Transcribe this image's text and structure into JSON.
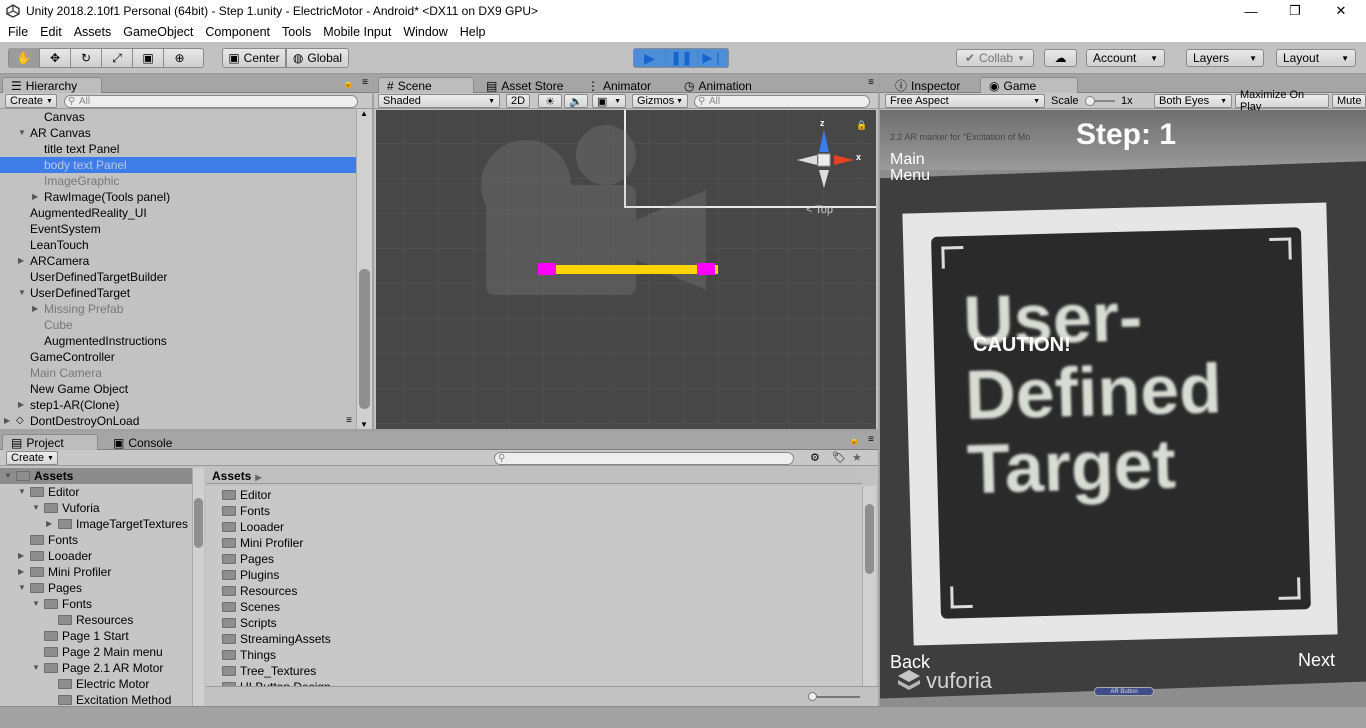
{
  "window": {
    "title": "Unity 2018.2.10f1 Personal (64bit) - Step 1.unity - ElectricMotor - Android* <DX11 on DX9 GPU>",
    "min": "—",
    "max": "❐",
    "close": "✕"
  },
  "menu": [
    "File",
    "Edit",
    "Assets",
    "GameObject",
    "Component",
    "Tools",
    "Mobile Input",
    "Window",
    "Help"
  ],
  "toolbar": {
    "center": "Center",
    "global": "Global",
    "collab": "Collab",
    "account": "Account",
    "layers": "Layers",
    "layout": "Layout"
  },
  "hierarchy": {
    "tab": "Hierarchy",
    "create": "Create",
    "search_placeholder": "All",
    "rows": [
      {
        "t": "Canvas",
        "d": 2,
        "a": "",
        "s": false,
        "dim": false
      },
      {
        "t": "AR Canvas",
        "d": 1,
        "a": "open",
        "s": false,
        "dim": false
      },
      {
        "t": "title text Panel",
        "d": 2,
        "a": "",
        "s": false,
        "dim": false
      },
      {
        "t": "body text Panel",
        "d": 2,
        "a": "",
        "s": true,
        "dim": true
      },
      {
        "t": "ImageGraphic",
        "d": 2,
        "a": "",
        "s": false,
        "dim": true
      },
      {
        "t": "RawImage(Tools panel)",
        "d": 2,
        "a": "closed",
        "s": false,
        "dim": false
      },
      {
        "t": "AugmentedReality_UI",
        "d": 1,
        "a": "",
        "s": false,
        "dim": false
      },
      {
        "t": "EventSystem",
        "d": 1,
        "a": "",
        "s": false,
        "dim": false
      },
      {
        "t": "LeanTouch",
        "d": 1,
        "a": "",
        "s": false,
        "dim": false
      },
      {
        "t": "ARCamera",
        "d": 1,
        "a": "closed",
        "s": false,
        "dim": false
      },
      {
        "t": "UserDefinedTargetBuilder",
        "d": 1,
        "a": "",
        "s": false,
        "dim": false
      },
      {
        "t": "UserDefinedTarget",
        "d": 1,
        "a": "open",
        "s": false,
        "dim": false
      },
      {
        "t": "Missing Prefab",
        "d": 2,
        "a": "closed",
        "s": false,
        "dim": true
      },
      {
        "t": "Cube",
        "d": 2,
        "a": "",
        "s": false,
        "dim": true
      },
      {
        "t": "AugmentedInstructions",
        "d": 2,
        "a": "",
        "s": false,
        "dim": false
      },
      {
        "t": "GameController",
        "d": 1,
        "a": "",
        "s": false,
        "dim": false
      },
      {
        "t": "Main Camera",
        "d": 1,
        "a": "",
        "s": false,
        "dim": true
      },
      {
        "t": "New Game Object",
        "d": 1,
        "a": "",
        "s": false,
        "dim": false
      },
      {
        "t": "step1-AR(Clone)",
        "d": 1,
        "a": "closed",
        "s": false,
        "dim": false
      },
      {
        "t": "DontDestroyOnLoad",
        "d": 0,
        "a": "closed",
        "s": false,
        "dim": false
      }
    ]
  },
  "scene": {
    "tabs": [
      "Scene",
      "Asset Store",
      "Animator",
      "Animation"
    ],
    "shaded": "Shaded",
    "mode2d": "2D",
    "gizmos": "Gizmos",
    "search_placeholder": "All",
    "axis_x": "x",
    "axis_z": "z",
    "view_label": "< Top"
  },
  "inspector": {
    "tab": "Inspector"
  },
  "game": {
    "tab": "Game",
    "aspect": "Free Aspect",
    "scale_label": "Scale",
    "scale_value": "1x",
    "both_eyes": "Both Eyes",
    "maximize": "Maximize On Play",
    "mute": "Mute",
    "step": "Step: 1",
    "main_menu_1": "Main",
    "main_menu_2": "Menu",
    "small_caption": "2.2   AR marker for \"Excitation of Mo",
    "caution": "CAUTION!",
    "marker_1": "User-",
    "marker_2": "Defined",
    "marker_3": "Target",
    "back": "Back",
    "vuforia": "vuforia",
    "next": "Next",
    "ar_button": "AR Button"
  },
  "project": {
    "tabs": [
      "Project",
      "Console"
    ],
    "create": "Create",
    "tree": [
      {
        "t": "Assets",
        "d": 0,
        "a": "open",
        "s": true
      },
      {
        "t": "Editor",
        "d": 1,
        "a": "open",
        "s": false
      },
      {
        "t": "Vuforia",
        "d": 2,
        "a": "open",
        "s": false
      },
      {
        "t": "ImageTargetTextures",
        "d": 3,
        "a": "closed",
        "s": false
      },
      {
        "t": "Fonts",
        "d": 1,
        "a": "",
        "s": false
      },
      {
        "t": "Looader",
        "d": 1,
        "a": "closed",
        "s": false
      },
      {
        "t": "Mini Profiler",
        "d": 1,
        "a": "closed",
        "s": false
      },
      {
        "t": "Pages",
        "d": 1,
        "a": "open",
        "s": false
      },
      {
        "t": "Fonts",
        "d": 2,
        "a": "open",
        "s": false
      },
      {
        "t": "Resources",
        "d": 3,
        "a": "",
        "s": false
      },
      {
        "t": "Page 1 Start",
        "d": 2,
        "a": "",
        "s": false
      },
      {
        "t": "Page 2 Main menu",
        "d": 2,
        "a": "",
        "s": false
      },
      {
        "t": "Page 2.1 AR Motor",
        "d": 2,
        "a": "open",
        "s": false
      },
      {
        "t": "Electric Motor",
        "d": 3,
        "a": "",
        "s": false
      },
      {
        "t": "Excitation Method",
        "d": 3,
        "a": "",
        "s": false
      }
    ],
    "breadcrumb": "Assets",
    "folders": [
      "Editor",
      "Fonts",
      "Looader",
      "Mini Profiler",
      "Pages",
      "Plugins",
      "Resources",
      "Scenes",
      "Scripts",
      "StreamingAssets",
      "Things",
      "Tree_Textures",
      "UI Button Design"
    ]
  }
}
